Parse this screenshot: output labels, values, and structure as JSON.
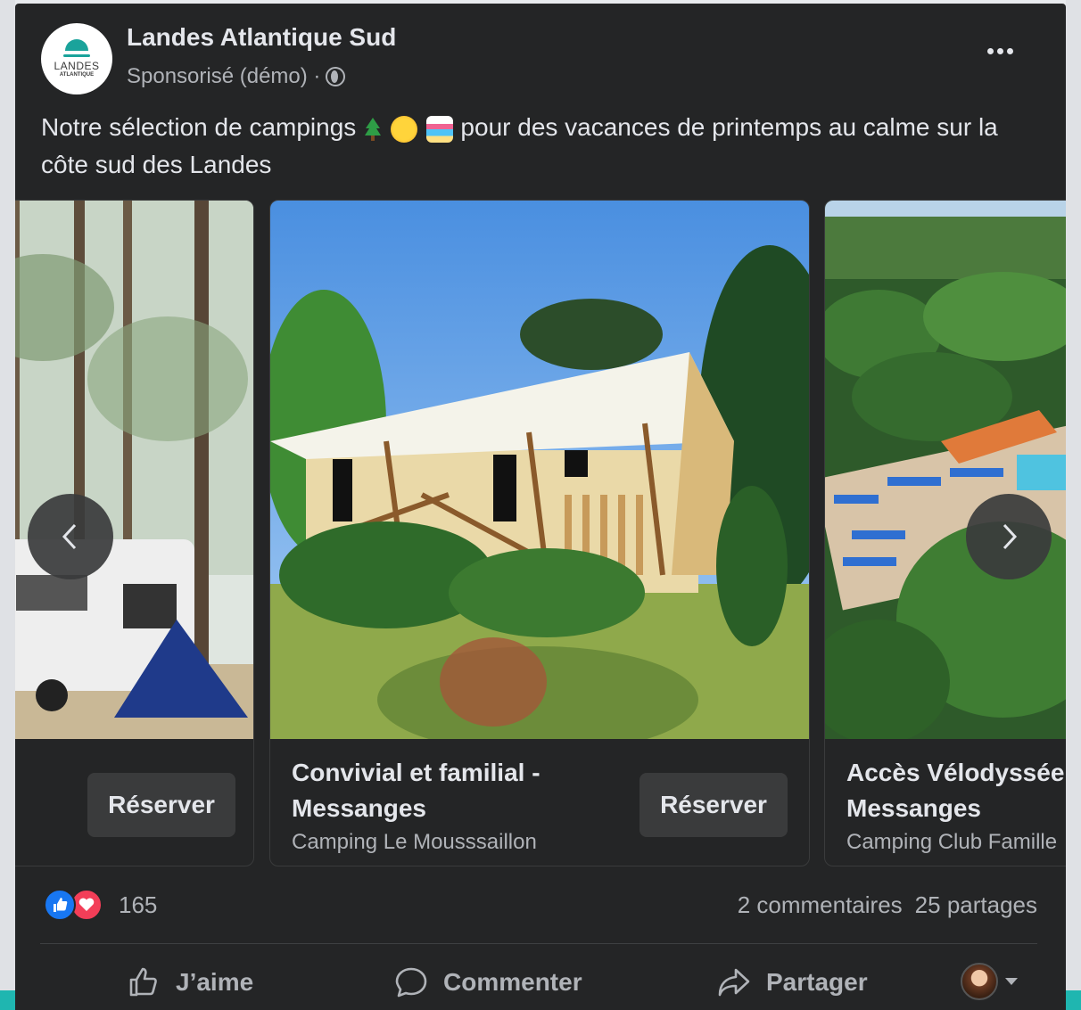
{
  "post": {
    "page_name": "Landes Atlantique Sud",
    "avatar_logo_line1": "LANDES",
    "avatar_logo_line2": "ATLANTIQUE",
    "meta_text": "Sponsorisé (démo) ·",
    "caption_part1": "Notre sélection de campings ",
    "caption_part2": " pour des vacances de printemps au calme sur la côte sud des Landes",
    "emojis": [
      "evergreen-tree",
      "sun",
      "beach-umbrella"
    ]
  },
  "carousel": {
    "cards": [
      {
        "title": "",
        "subtitle": "",
        "cta": "Réserver"
      },
      {
        "title": "Convivial et familial - Messanges",
        "subtitle": "Camping Le Mousssaillon",
        "cta": "Réserver"
      },
      {
        "title": "Accès Vélodyssée - Messanges",
        "subtitle": "Camping Club Famille",
        "cta": ""
      }
    ]
  },
  "engagement": {
    "reaction_count": "165",
    "comments": "2 commentaires",
    "shares": "25 partages",
    "reactions": [
      "like-icon",
      "love-icon"
    ]
  },
  "actions": {
    "like": "J’aime",
    "comment": "Commenter",
    "share": "Partager"
  },
  "colors": {
    "background": "#242526",
    "text": "#e4e6eb",
    "secondary_text": "#b0b3b8",
    "like_blue": "#1877f2",
    "love_red": "#f33e58"
  }
}
